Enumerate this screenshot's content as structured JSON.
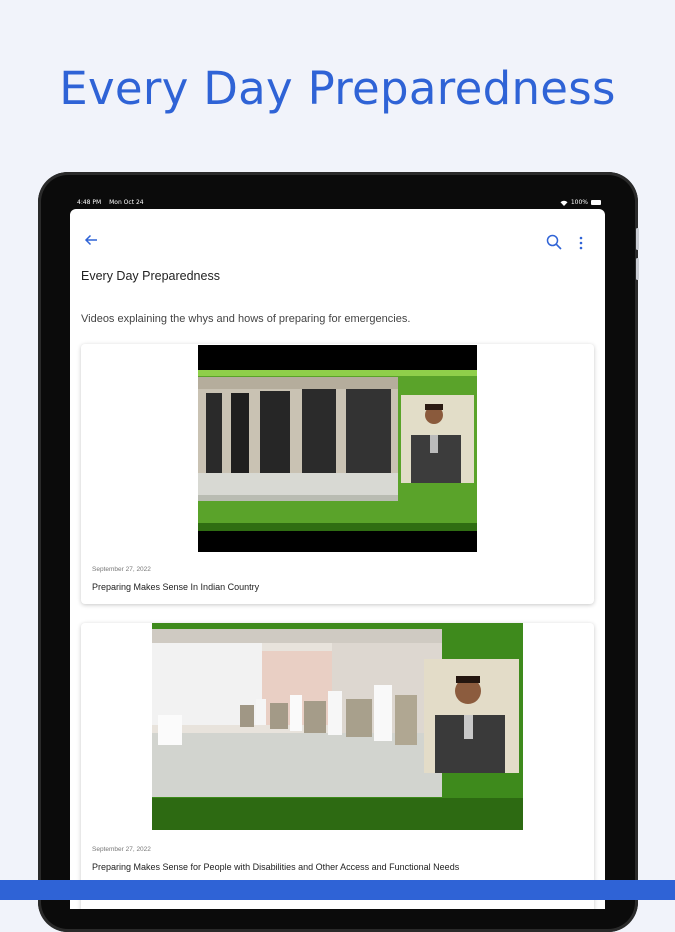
{
  "promo": {
    "headline": "Every Day Preparedness"
  },
  "status_bar": {
    "time": "4:48 PM",
    "date": "Mon Oct 24",
    "battery": "100%"
  },
  "app_bar": {
    "back_icon": "arrow-left-icon",
    "search_icon": "search-icon",
    "menu_icon": "more-vertical-icon"
  },
  "page": {
    "title": "Every Day Preparedness",
    "description": "Videos explaining the whys and hows of preparing for emergencies."
  },
  "videos": [
    {
      "date": "September 27, 2022",
      "title": "Preparing Makes Sense In Indian Country"
    },
    {
      "date": "September 27, 2022",
      "title": "Preparing Makes Sense for People with Disabilities and Other Access and Functional Needs"
    }
  ],
  "colors": {
    "accent": "#2f63d6",
    "background": "#f1f3fa",
    "video_green": "#4f9a22"
  }
}
